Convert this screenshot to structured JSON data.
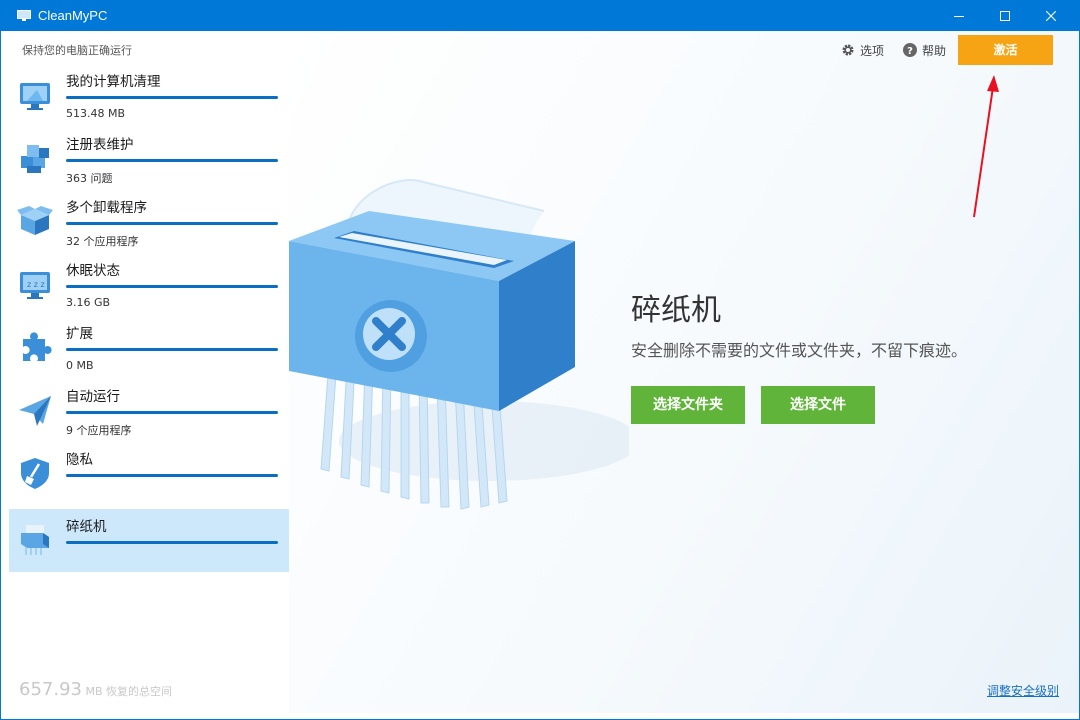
{
  "window": {
    "title": "CleanMyPC"
  },
  "sidebar": {
    "tagline": "保持您的电脑正确运行",
    "items": [
      {
        "label": "我的计算机清理",
        "value": "513.48 MB",
        "icon": "computer-icon"
      },
      {
        "label": "注册表维护",
        "value": "363 问题",
        "icon": "registry-cubes-icon"
      },
      {
        "label": "多个卸载程序",
        "value": "32 个应用程序",
        "icon": "uninstaller-box-icon"
      },
      {
        "label": "休眠状态",
        "value": "3.16 GB",
        "icon": "hibernation-monitor-icon"
      },
      {
        "label": "扩展",
        "value": "0 MB",
        "icon": "puzzle-icon"
      },
      {
        "label": "自动运行",
        "value": "9 个应用程序",
        "icon": "paper-plane-icon"
      },
      {
        "label": "隐私",
        "value": "",
        "icon": "shield-broom-icon"
      },
      {
        "label": "碎纸机",
        "value": "",
        "icon": "shredder-icon",
        "active": true
      }
    ],
    "total_number": "657.93",
    "total_unit": "MB 恢复的总空间"
  },
  "header": {
    "options_label": "选项",
    "help_label": "帮助",
    "activate_label": "激活"
  },
  "feature": {
    "title": "碎纸机",
    "description": "安全删除不需要的文件或文件夹，不留下痕迹。",
    "select_folder_label": "选择文件夹",
    "select_file_label": "选择文件"
  },
  "footer": {
    "security_link": "调整安全级别"
  },
  "colors": {
    "titlebar": "#0078d7",
    "activate": "#f7a414",
    "green_button": "#61b43a",
    "progress_bar": "#0a6fc2",
    "active_item": "#cde8fb",
    "arrow": "#e81123"
  }
}
